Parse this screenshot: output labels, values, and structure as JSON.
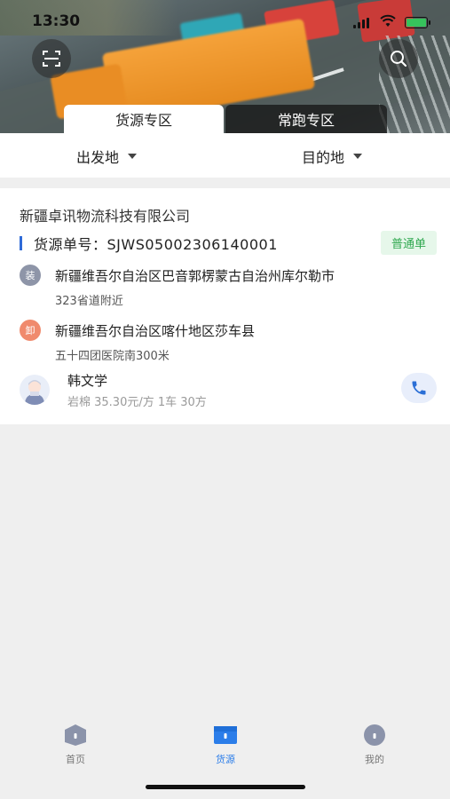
{
  "status_bar": {
    "time": "13:30"
  },
  "header": {
    "tabs": [
      {
        "label": "货源专区",
        "active": true
      },
      {
        "label": "常跑专区",
        "active": false
      }
    ]
  },
  "filters": {
    "origin": "出发地",
    "destination": "目的地"
  },
  "listing": {
    "company": "新疆卓讯物流科技有限公司",
    "order_label": "货源单号：",
    "order_no": "SJWS05002306140001",
    "order_type": "普通单",
    "load": {
      "tag": "装",
      "address": "新疆维吾尔自治区巴音郭楞蒙古自治州库尔勒市",
      "detail": "323省道附近"
    },
    "unload": {
      "tag": "卸",
      "address": "新疆维吾尔自治区喀什地区莎车县",
      "detail": "五十四团医院南300米"
    },
    "contact": {
      "name": "韩文学",
      "desc": "岩棉 35.30元/方 1车 30方"
    }
  },
  "bottom_nav": [
    {
      "label": "首页",
      "active": false,
      "icon": "home-icon"
    },
    {
      "label": "货源",
      "active": true,
      "icon": "goods-icon"
    },
    {
      "label": "我的",
      "active": false,
      "icon": "profile-icon"
    }
  ],
  "colors": {
    "accent": "#2b7de9",
    "badge_green": "#2fa84f",
    "load_tag": "#8e95a8",
    "unload_tag": "#f08a6d"
  }
}
